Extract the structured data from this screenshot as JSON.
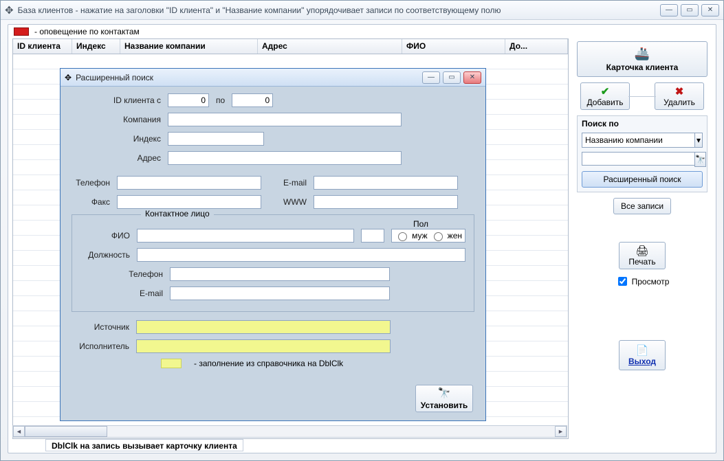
{
  "mainWindow": {
    "title": "База клиентов - нажатие на заголовки \"ID клиента\" и \"Название компании\" упорядочивает записи по соответствующему полю",
    "noticeText": "- оповещение по контактам",
    "footerHint": "DblClk на запись вызывает карточку клиента"
  },
  "columns": {
    "id": "ID клиента",
    "index": "Индекс",
    "company": "Название компании",
    "address": "Адрес",
    "fio": "ФИО",
    "pos": "До..."
  },
  "rightPanel": {
    "cardBtn": "Карточка клиента",
    "addBtn": "Добавить",
    "deleteBtn": "Удалить",
    "searchBoxTitle": "Поиск по",
    "searchByValue": "Названию компании",
    "advancedSearchBtn": "Расширенный поиск",
    "allRecordsBtn": "Все записи",
    "printBtn": "Печать",
    "previewChk": "Просмотр",
    "exitBtn": "Выход"
  },
  "dialog": {
    "title": "Расширенный поиск",
    "idFromLbl": "ID клиента с",
    "idFromVal": "0",
    "idToLbl": "по",
    "idToVal": "0",
    "companyLbl": "Компания",
    "indexLbl": "Индекс",
    "addressLbl": "Адрес",
    "phoneLbl": "Телефон",
    "emailLbl": "E-mail",
    "faxLbl": "Факс",
    "wwwLbl": "WWW",
    "contactLegend": "Контактное лицо",
    "fioLbl": "ФИО",
    "sexLbl": "Пол",
    "sexMale": "муж",
    "sexFemale": "жен",
    "positionLbl": "Должность",
    "contactPhoneLbl": "Телефон",
    "contactEmailLbl": "E-mail",
    "sourceLbl": "Источник",
    "executorLbl": "Исполнитель",
    "yellowHint": "- заполнение из справочника на DblClk",
    "applyBtn": "Установить"
  }
}
